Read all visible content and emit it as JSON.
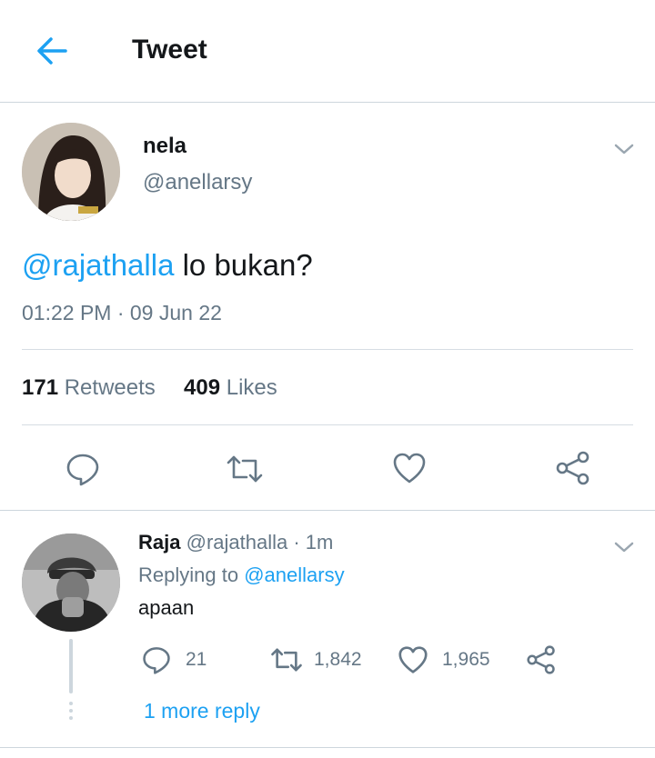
{
  "header": {
    "title": "Tweet"
  },
  "tweet": {
    "display_name": "nela",
    "handle": "@anellarsy",
    "mention": "@rajathalla",
    "text": " lo bukan?",
    "timestamp": "01:22 PM · 09 Jun 22",
    "retweets_count": "171",
    "retweets_label": "Retweets",
    "likes_count": "409",
    "likes_label": "Likes"
  },
  "reply": {
    "display_name": "Raja",
    "handle": "@rajathalla",
    "time": "· 1m",
    "replying_to_label": "Replying to",
    "replying_to_handle": "@anellarsy",
    "text": "apaan",
    "reply_count": "21",
    "retweet_count": "1,842",
    "like_count": "1,965",
    "more_replies": "1 more reply"
  },
  "colors": {
    "accent": "#1da1f2",
    "muted": "#657786",
    "text": "#14171a"
  }
}
